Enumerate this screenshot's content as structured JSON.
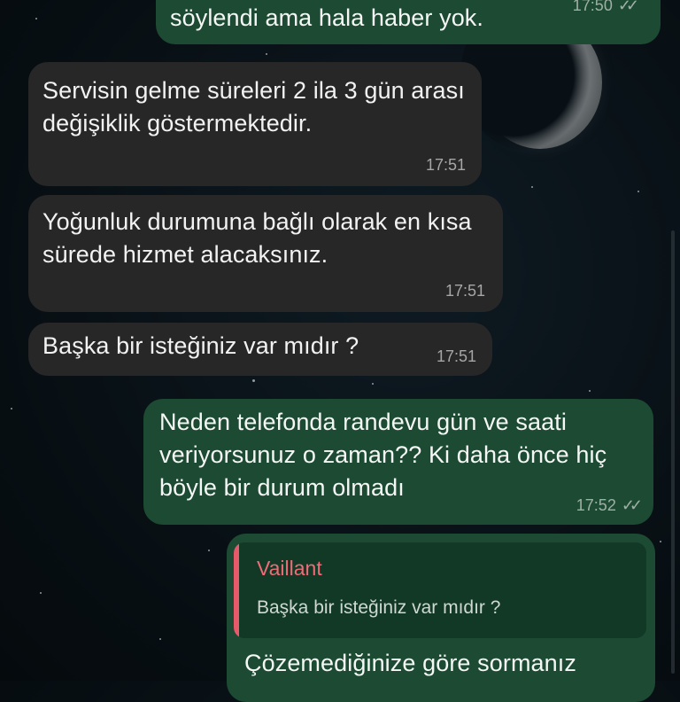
{
  "colors": {
    "outgoing_bubble": "#1d4a32",
    "incoming_bubble": "#272727",
    "quote_accent": "#e8596a",
    "background": "#081015"
  },
  "messages": [
    {
      "direction": "outgoing",
      "text": "söylendi ama hala haber yok.",
      "time": "17:50",
      "status_icon": "double-check-icon"
    },
    {
      "direction": "incoming",
      "text": "Servisin gelme süreleri 2 ila 3 gün arası değişiklik göstermektedir.",
      "time": "17:51"
    },
    {
      "direction": "incoming",
      "text": "Yoğunluk durumuna bağlı olarak en kısa sürede hizmet alacaksınız.",
      "time": "17:51"
    },
    {
      "direction": "incoming",
      "text": "Başka bir isteğiniz var mıdır ?",
      "time": "17:51"
    },
    {
      "direction": "outgoing",
      "text": "Neden telefonda randevu gün ve saati veriyorsunuz o zaman?? Ki daha önce hiç böyle bir durum olmadı",
      "time": "17:52",
      "status_icon": "double-check-icon"
    },
    {
      "direction": "outgoing",
      "reply_to": {
        "author": "Vaillant",
        "text": "Başka bir isteğiniz var mıdır ?"
      },
      "text": "Çözemediğinize göre sormanız"
    }
  ],
  "ticks_glyph": "✓✓"
}
